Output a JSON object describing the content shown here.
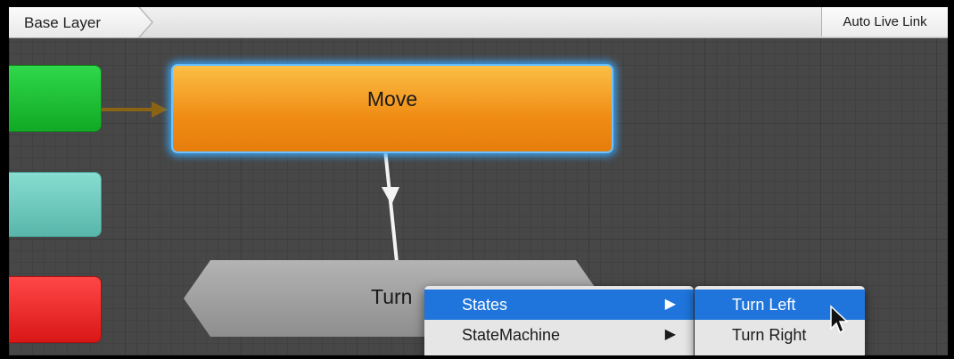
{
  "header": {
    "breadcrumb": "Base Layer",
    "live_link_label": "Auto Live Link"
  },
  "nodes": {
    "move": "Move",
    "turn": "Turn"
  },
  "context_menu": {
    "items": [
      {
        "label": "States",
        "arrow": "▶"
      },
      {
        "label": "StateMachine",
        "arrow": "▶"
      }
    ],
    "submenu": [
      {
        "label": "Turn Left"
      },
      {
        "label": "Turn Right"
      }
    ]
  },
  "colors": {
    "move_node": "#f08c14",
    "selection_glow": "#3aa3f4",
    "menu_highlight": "#1f75dc",
    "green_node": "#11a925",
    "teal_node": "#58b7aa",
    "red_node": "#d91717"
  }
}
